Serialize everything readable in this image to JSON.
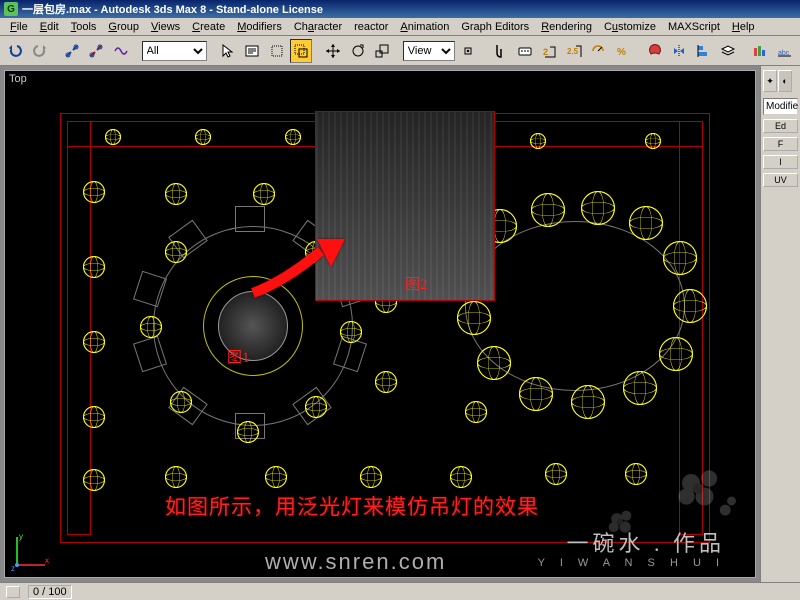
{
  "title": "一层包房.max - Autodesk 3ds Max 8 - Stand-alone License",
  "menu": [
    "File",
    "Edit",
    "Tools",
    "Group",
    "Views",
    "Create",
    "Modifiers",
    "Character",
    "reactor",
    "Animation",
    "Graph Editors",
    "Rendering",
    "Customize",
    "MAXScript",
    "Help"
  ],
  "toolbar": {
    "selection_filter": "All",
    "ref_coord": "View"
  },
  "viewport": {
    "label": "Top",
    "annotation_main": "如图所示，用泛光灯来模仿吊灯的效果",
    "inset_label": "图2",
    "center_label": "图1",
    "watermark_cn": "一碗水 . 作品",
    "watermark_py": "Y I   W A N   S H U I",
    "watermark_url": "www.snren.com"
  },
  "side": {
    "rollout": "Modifie",
    "btns": [
      "Ed",
      "F",
      "I",
      "UV"
    ]
  },
  "status": {
    "frame": "0 / 100"
  }
}
